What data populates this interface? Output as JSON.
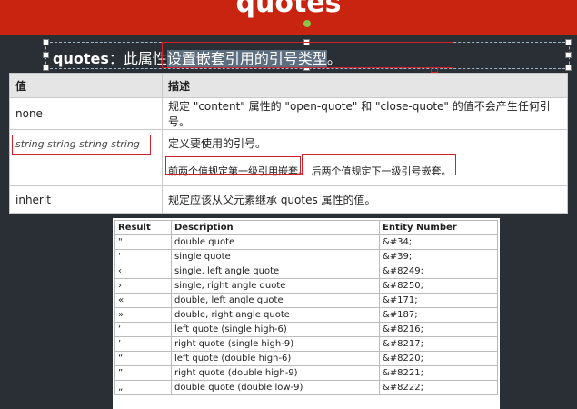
{
  "slide": {
    "title": "quotes",
    "heading_bold": "quotes",
    "heading_text": "：此属性",
    "heading_selected": "设置嵌套引用的引号类型",
    "heading_end": "。"
  },
  "property_table": {
    "headers": [
      "值",
      "描述"
    ],
    "rows": [
      {
        "value": "none",
        "desc": "规定 \"content\" 属性的 \"open-quote\" 和 \"close-quote\" 的值不会产生任何引号。"
      },
      {
        "value": "string string string string",
        "desc": "定义要使用的引号。",
        "note_a": "前两个值规定第一级引用嵌套。",
        "note_b": "后两个值规定下一级引号嵌套。"
      },
      {
        "value": "inherit",
        "desc": "规定应该从父元素继承 quotes 属性的值。"
      }
    ]
  },
  "entity_table": {
    "headers": [
      "Result",
      "Description",
      "Entity Number"
    ],
    "rows": [
      {
        "result": "\"",
        "desc": "double quote",
        "num": "&#34;"
      },
      {
        "result": "'",
        "desc": "single quote",
        "num": "&#39;"
      },
      {
        "result": "‹",
        "desc": "single, left angle quote",
        "num": "&#8249;"
      },
      {
        "result": "›",
        "desc": "single, right angle quote",
        "num": "&#8250;"
      },
      {
        "result": "«",
        "desc": "double, left angle quote",
        "num": "&#171;"
      },
      {
        "result": "»",
        "desc": "double, right angle quote",
        "num": "&#187;"
      },
      {
        "result": "‘",
        "desc": "left quote (single high-6)",
        "num": "&#8216;"
      },
      {
        "result": "’",
        "desc": "right quote (single high-9)",
        "num": "&#8217;"
      },
      {
        "result": "“",
        "desc": "left quote (double high-6)",
        "num": "&#8220;"
      },
      {
        "result": "”",
        "desc": "right quote (double high-9)",
        "num": "&#8221;"
      },
      {
        "result": "„",
        "desc": "double quote (double low-9)",
        "num": "&#8222;"
      }
    ]
  }
}
